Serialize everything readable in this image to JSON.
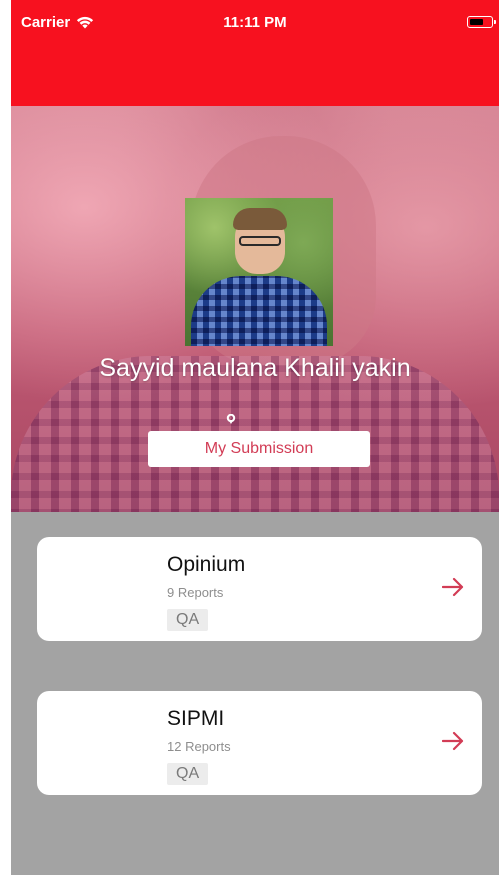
{
  "status_bar": {
    "carrier": "Carrier",
    "time": "11:11 PM"
  },
  "colors": {
    "nav_red": "#f7111f",
    "accent": "#d23c55",
    "list_bg": "#a3a3a3"
  },
  "profile": {
    "name": "Sayyid maulana Khalil yakin",
    "submission_button": "My Submission"
  },
  "projects": [
    {
      "title": "Opinium",
      "reports": "9 Reports",
      "tag": "QA",
      "icon": "arrow-right-icon"
    },
    {
      "title": "SIPMI",
      "reports": "12 Reports",
      "tag": "QA",
      "icon": "arrow-right-icon"
    }
  ]
}
